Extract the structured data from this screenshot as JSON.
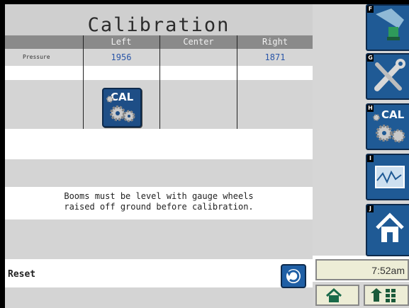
{
  "title": "Calibration",
  "table": {
    "headers": [
      "Left",
      "Center",
      "Right"
    ],
    "rows": [
      {
        "label": "Pressure",
        "left": "1956",
        "center": "",
        "right": "1871"
      }
    ]
  },
  "calibrate_button": {
    "label": "CAL"
  },
  "note": {
    "line1": "Booms must be level with gauge wheels",
    "line2": "raised off ground before calibration."
  },
  "reset": {
    "label": "Reset"
  },
  "side_buttons": [
    {
      "key": "F",
      "icon": "machine-icon"
    },
    {
      "key": "G",
      "icon": "tools-icon"
    },
    {
      "key": "H",
      "icon": "calibration-icon",
      "label": "CAL"
    },
    {
      "key": "I",
      "icon": "waveform-icon"
    },
    {
      "key": "J",
      "icon": "home-icon"
    }
  ],
  "clock": {
    "time": "7:52am"
  },
  "bottom_buttons": [
    {
      "icon": "home-icon"
    },
    {
      "icon": "up-arrow-grid-icon"
    }
  ],
  "colors": {
    "panel_gray": "#d4d4d4",
    "header_gray": "#8a8a8a",
    "value_blue": "#2a56a8",
    "button_blue": "#1f5a95"
  }
}
